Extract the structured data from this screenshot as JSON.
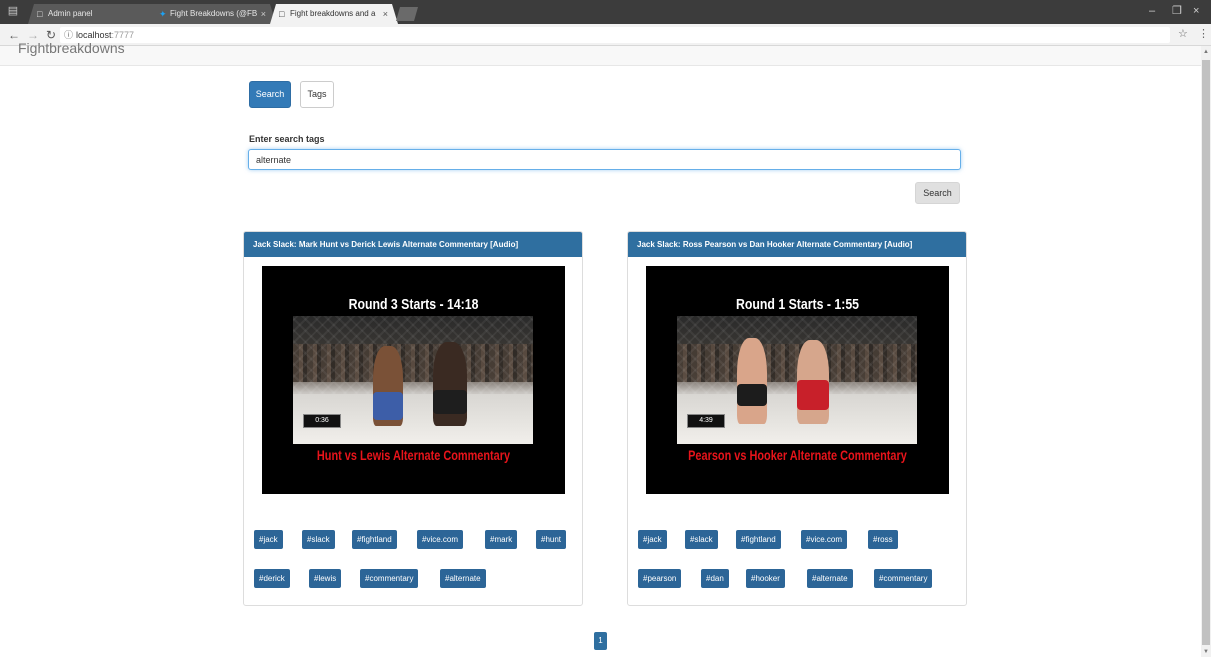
{
  "browser": {
    "tabs": [
      {
        "title": "Admin panel",
        "icon": "page-icon",
        "active": false
      },
      {
        "title": "Fight Breakdowns (@FB",
        "icon": "twitter-icon",
        "active": false
      },
      {
        "title": "Fight breakdowns and a",
        "icon": "page-icon",
        "active": true
      }
    ],
    "url_host": "localhost",
    "url_port": ":7777",
    "close_glyph": "×"
  },
  "page": {
    "brand": "Fightbreakdowns",
    "nav_buttons": {
      "search": "Search",
      "tags": "Tags"
    },
    "search_label": "Enter search tags",
    "search_value": "alternate",
    "search_submit": "Search",
    "results": [
      {
        "title": "Jack Slack: Mark Hunt vs Derick Lewis Alternate Commentary [Audio]",
        "thumb_title": "Round 3 Starts - 14:18",
        "thumb_subtitle": "Hunt vs Lewis Alternate Commentary",
        "score": "0:36",
        "tags": [
          "#jack",
          "#slack",
          "#fightland",
          "#vice.com",
          "#mark",
          "#hunt",
          "#derick",
          "#lewis",
          "#commentary",
          "#alternate"
        ]
      },
      {
        "title": "Jack Slack: Ross Pearson vs Dan Hooker Alternate Commentary [Audio]",
        "thumb_title": "Round 1 Starts - 1:55",
        "thumb_subtitle": "Pearson vs Hooker Alternate Commentary",
        "score": "4:39",
        "tags": [
          "#jack",
          "#slack",
          "#fightland",
          "#vice.com",
          "#ross",
          "#pearson",
          "#dan",
          "#hooker",
          "#alternate",
          "#commentary"
        ]
      }
    ],
    "pagination": [
      "1"
    ]
  },
  "colors": {
    "primary": "#337ab7",
    "panel_heading": "#2f6fa0",
    "tag": "#2c6597",
    "subtitle_red": "#e8141b"
  }
}
